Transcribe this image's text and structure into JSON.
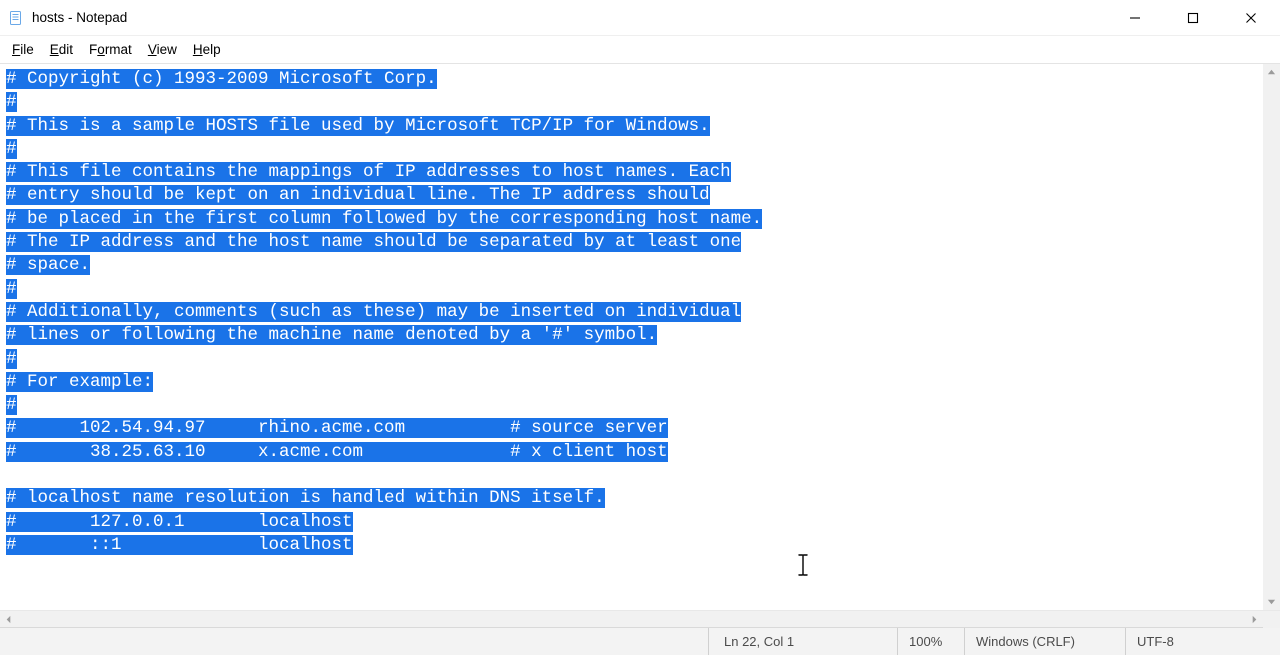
{
  "window": {
    "title": "hosts - Notepad"
  },
  "menu": {
    "file": "File",
    "edit": "Edit",
    "format": "Format",
    "view": "View",
    "help": "Help"
  },
  "editor": {
    "lines": [
      "# Copyright (c) 1993-2009 Microsoft Corp.",
      "#",
      "# This is a sample HOSTS file used by Microsoft TCP/IP for Windows.",
      "#",
      "# This file contains the mappings of IP addresses to host names. Each",
      "# entry should be kept on an individual line. The IP address should",
      "# be placed in the first column followed by the corresponding host name.",
      "# The IP address and the host name should be separated by at least one",
      "# space.",
      "#",
      "# Additionally, comments (such as these) may be inserted on individual",
      "# lines or following the machine name denoted by a '#' symbol.",
      "#",
      "# For example:",
      "#",
      "#      102.54.94.97     rhino.acme.com          # source server",
      "#       38.25.63.10     x.acme.com              # x client host",
      "",
      "# localhost name resolution is handled within DNS itself.",
      "#       127.0.0.1       localhost",
      "#       ::1             localhost"
    ],
    "selection": "all"
  },
  "status": {
    "caret": "Ln 22, Col 1",
    "zoom": "100%",
    "eol": "Windows (CRLF)",
    "encoding": "UTF-8"
  }
}
